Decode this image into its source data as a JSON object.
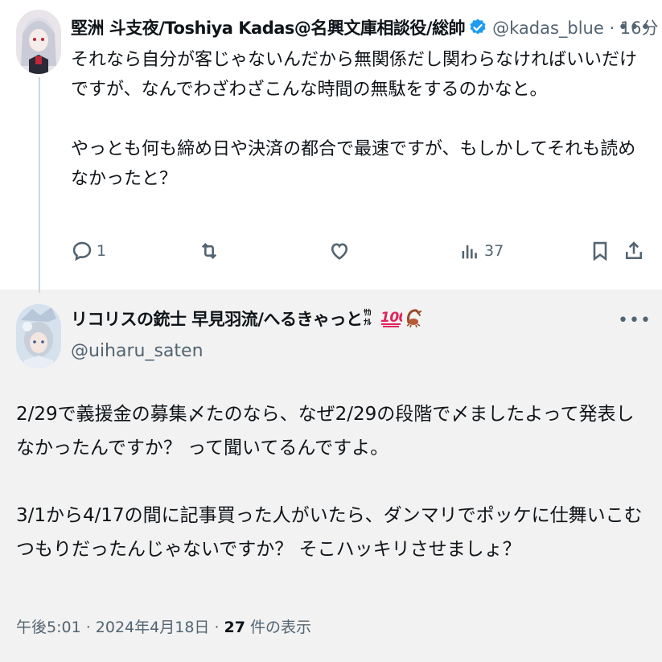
{
  "colors": {
    "accent": "#1d9bf0",
    "secondary_text": "#536471",
    "primary_text": "#0f1419",
    "thread_line": "#cfd9de"
  },
  "tweet1": {
    "display_name": "堅洲 斗支夜/Toshiya Kadas@名興文庫相談役/総帥",
    "verified_icon": "verified-badge-icon",
    "handle_time": "@kadas_blue · 16分",
    "text": "それなら自分が客じゃないんだから無関係だし関わらなければいいだけですが、なんでわざわざこんな時間の無駄をするのかなと。\n\nやっとも何も締め日や決済の都合で最速ですが、もしかしてそれも読めなかったと？",
    "actions": {
      "reply_count": "1",
      "retweet_count": "",
      "like_count": "",
      "views_count": "37"
    }
  },
  "tweet2": {
    "display_name": "リコリスの銃士 早見羽流/へるきゃっと",
    "name_emojis": [
      "sakana-kanji-icon",
      "hundred-points-icon",
      "scorpion-icon"
    ],
    "handle": "@uiharu_saten",
    "text": "2/29で義援金の募集〆たのなら、なぜ2/29の段階で〆ましたよって発表しなかったんですか？ って聞いてるんですよ。\n\n3/1から4/17の間に記事買った人がいたら、ダンマリでポッケに仕舞いこむつもりだったんじゃないですか？ そこハッキリさせましょ？",
    "timestamp": "午後5:01 · 2024年4月18日 · ",
    "views_number": "27",
    "views_label": " 件の表示"
  }
}
